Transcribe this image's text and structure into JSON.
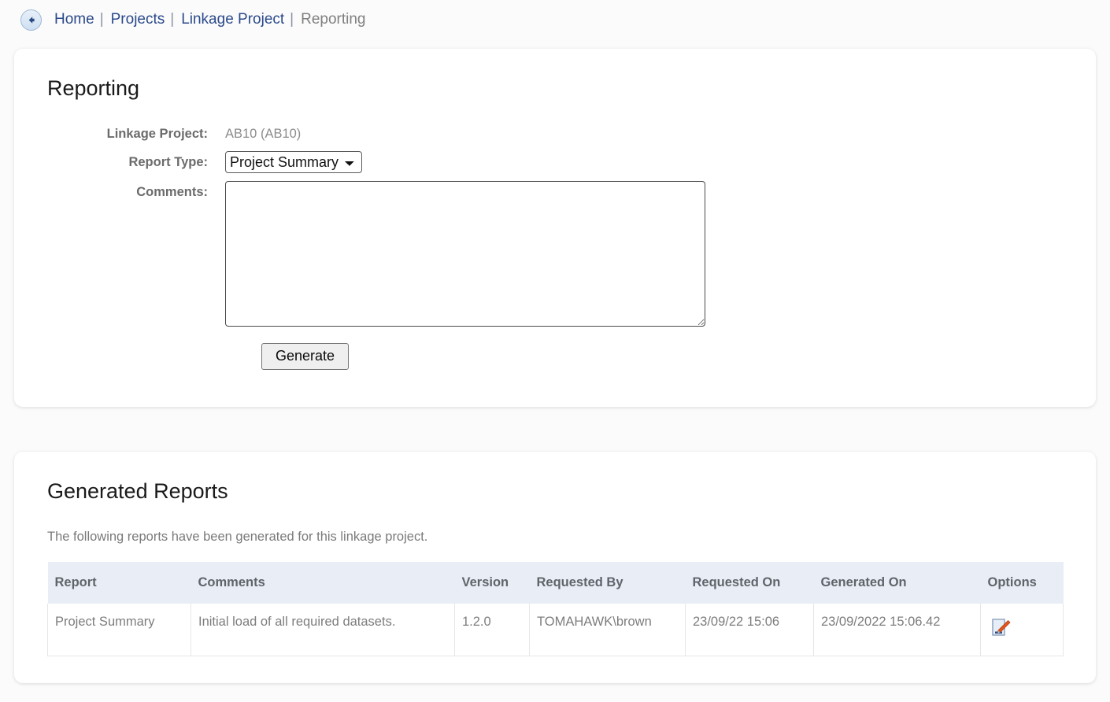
{
  "breadcrumb": {
    "back_icon": "back-arrow-circle-icon",
    "separator": "|",
    "items": [
      {
        "label": "Home",
        "current": false
      },
      {
        "label": "Projects",
        "current": false
      },
      {
        "label": "Linkage Project",
        "current": false
      },
      {
        "label": "Reporting",
        "current": true
      }
    ]
  },
  "reporting_card": {
    "title": "Reporting",
    "fields": {
      "linkage_project_label": "Linkage Project:",
      "linkage_project_value": "AB10 (AB10)",
      "report_type_label": "Report Type:",
      "report_type_value": "Project Summary",
      "report_type_options": [
        "Project Summary"
      ],
      "comments_label": "Comments:",
      "comments_value": "",
      "comments_placeholder": ""
    },
    "generate_button": "Generate"
  },
  "reports_card": {
    "title": "Generated Reports",
    "description": "The following reports have been generated for this linkage project.",
    "table": {
      "columns": [
        "Report",
        "Comments",
        "Version",
        "Requested By",
        "Requested On",
        "Generated On",
        "Options"
      ],
      "rows": [
        {
          "report": "Project Summary",
          "comments": "Initial load of all required datasets.",
          "version": "1.2.0",
          "requested_by": "TOMAHAWK\\brown",
          "requested_on": "23/09/22 15:06",
          "generated_on": "23/09/2022 15:06.42",
          "options_icon": "edit-report-icon"
        }
      ]
    }
  },
  "colors": {
    "link": "#2b4a8b",
    "muted_text": "#808080",
    "table_header_bg": "#e9eef6",
    "page_bg": "#fbfbfb",
    "icon_pencil": "#e2571e"
  }
}
